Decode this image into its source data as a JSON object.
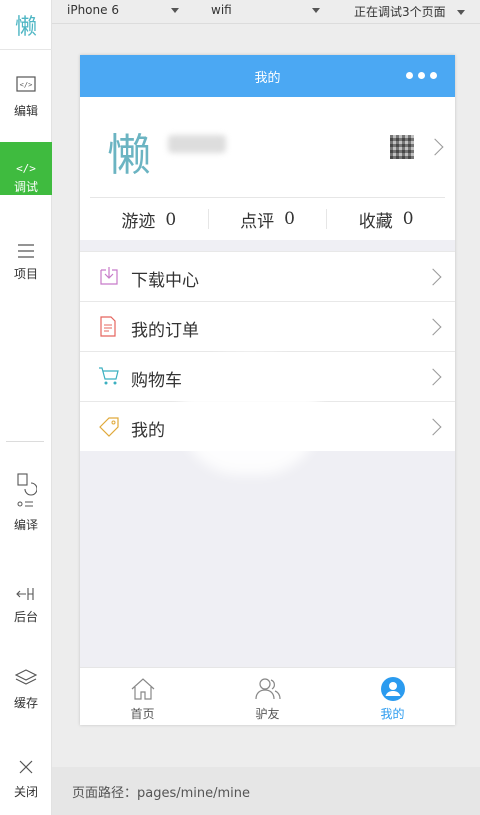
{
  "sidebar": {
    "logo": "懒",
    "items": [
      {
        "label": "编辑",
        "icon": "code-window-icon",
        "active": false
      },
      {
        "label": "调试",
        "icon": "code-icon",
        "active": true
      },
      {
        "label": "项目",
        "icon": "menu-lines-icon",
        "active": false
      },
      {
        "label": "编译",
        "icon": "compile-icon",
        "active": false
      },
      {
        "label": "后台",
        "icon": "backend-icon",
        "active": false
      },
      {
        "label": "缓存",
        "icon": "layers-icon",
        "active": false
      },
      {
        "label": "关闭",
        "icon": "close-icon",
        "active": false
      }
    ]
  },
  "topbar": {
    "device": "iPhone 6",
    "network": "wifi",
    "debug_status": "正在调试3个页面"
  },
  "phone": {
    "nav_title": "我的",
    "avatar_text": "懒",
    "stats": [
      {
        "label": "游迹",
        "value": "0"
      },
      {
        "label": "点评",
        "value": "0"
      },
      {
        "label": "收藏",
        "value": "0"
      }
    ],
    "menu": [
      {
        "label": "下载中心",
        "icon": "download-icon"
      },
      {
        "label": "我的订单",
        "icon": "order-doc-icon"
      },
      {
        "label": "购物车",
        "icon": "cart-icon"
      },
      {
        "label": "我的",
        "icon": "tag-icon"
      }
    ],
    "tabs": [
      {
        "label": "首页",
        "icon": "home-icon",
        "active": false
      },
      {
        "label": "驴友",
        "icon": "friends-icon",
        "active": false
      },
      {
        "label": "我的",
        "icon": "user-icon",
        "active": true
      }
    ]
  },
  "path": "页面路径：pages/mine/mine",
  "colors": {
    "accent_green": "#3fbb3f",
    "nav_blue": "#4ba8f3",
    "tab_active": "#2b9bef",
    "logo_teal": "#6bb4c2"
  }
}
